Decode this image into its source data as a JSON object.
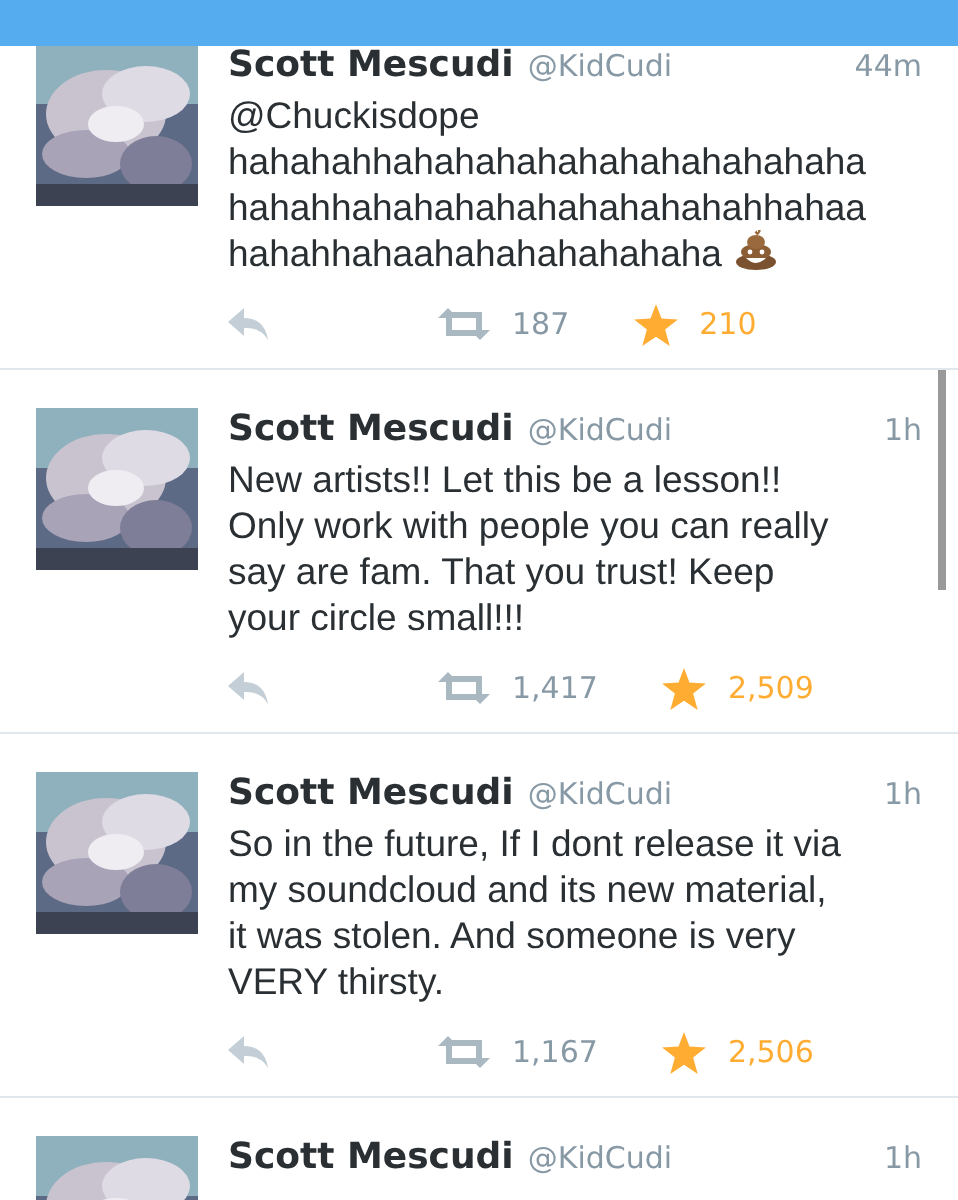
{
  "tweets": [
    {
      "name": "Scott Mescudi",
      "handle": "@KidCudi",
      "time": "44m",
      "body": "@Chuckisdope\nhahahahhahahahahahahahahahahaha\nhahahhahahahahahahahahahahhahaa\nhahahhahaahahahahahahaha",
      "ends_with_icon": true,
      "retweets": "187",
      "favorites": "210",
      "favorited": true
    },
    {
      "name": "Scott Mescudi",
      "handle": "@KidCudi",
      "time": "1h",
      "body": "New artists!! Let this be a lesson!!\nOnly work with people you can really\nsay are fam. That you trust! Keep\nyour circle small!!!",
      "retweets": "1,417",
      "favorites": "2,509",
      "favorited": true
    },
    {
      "name": "Scott Mescudi",
      "handle": "@KidCudi",
      "time": "1h",
      "body": "So in the future, If I dont release it via\nmy soundcloud and its new material,\nit was stolen.  And someone is very\nVERY thirsty.",
      "retweets": "1,167",
      "favorites": "2,506",
      "favorited": true
    },
    {
      "name": "Scott Mescudi",
      "handle": "@KidCudi",
      "time": "1h"
    }
  ]
}
